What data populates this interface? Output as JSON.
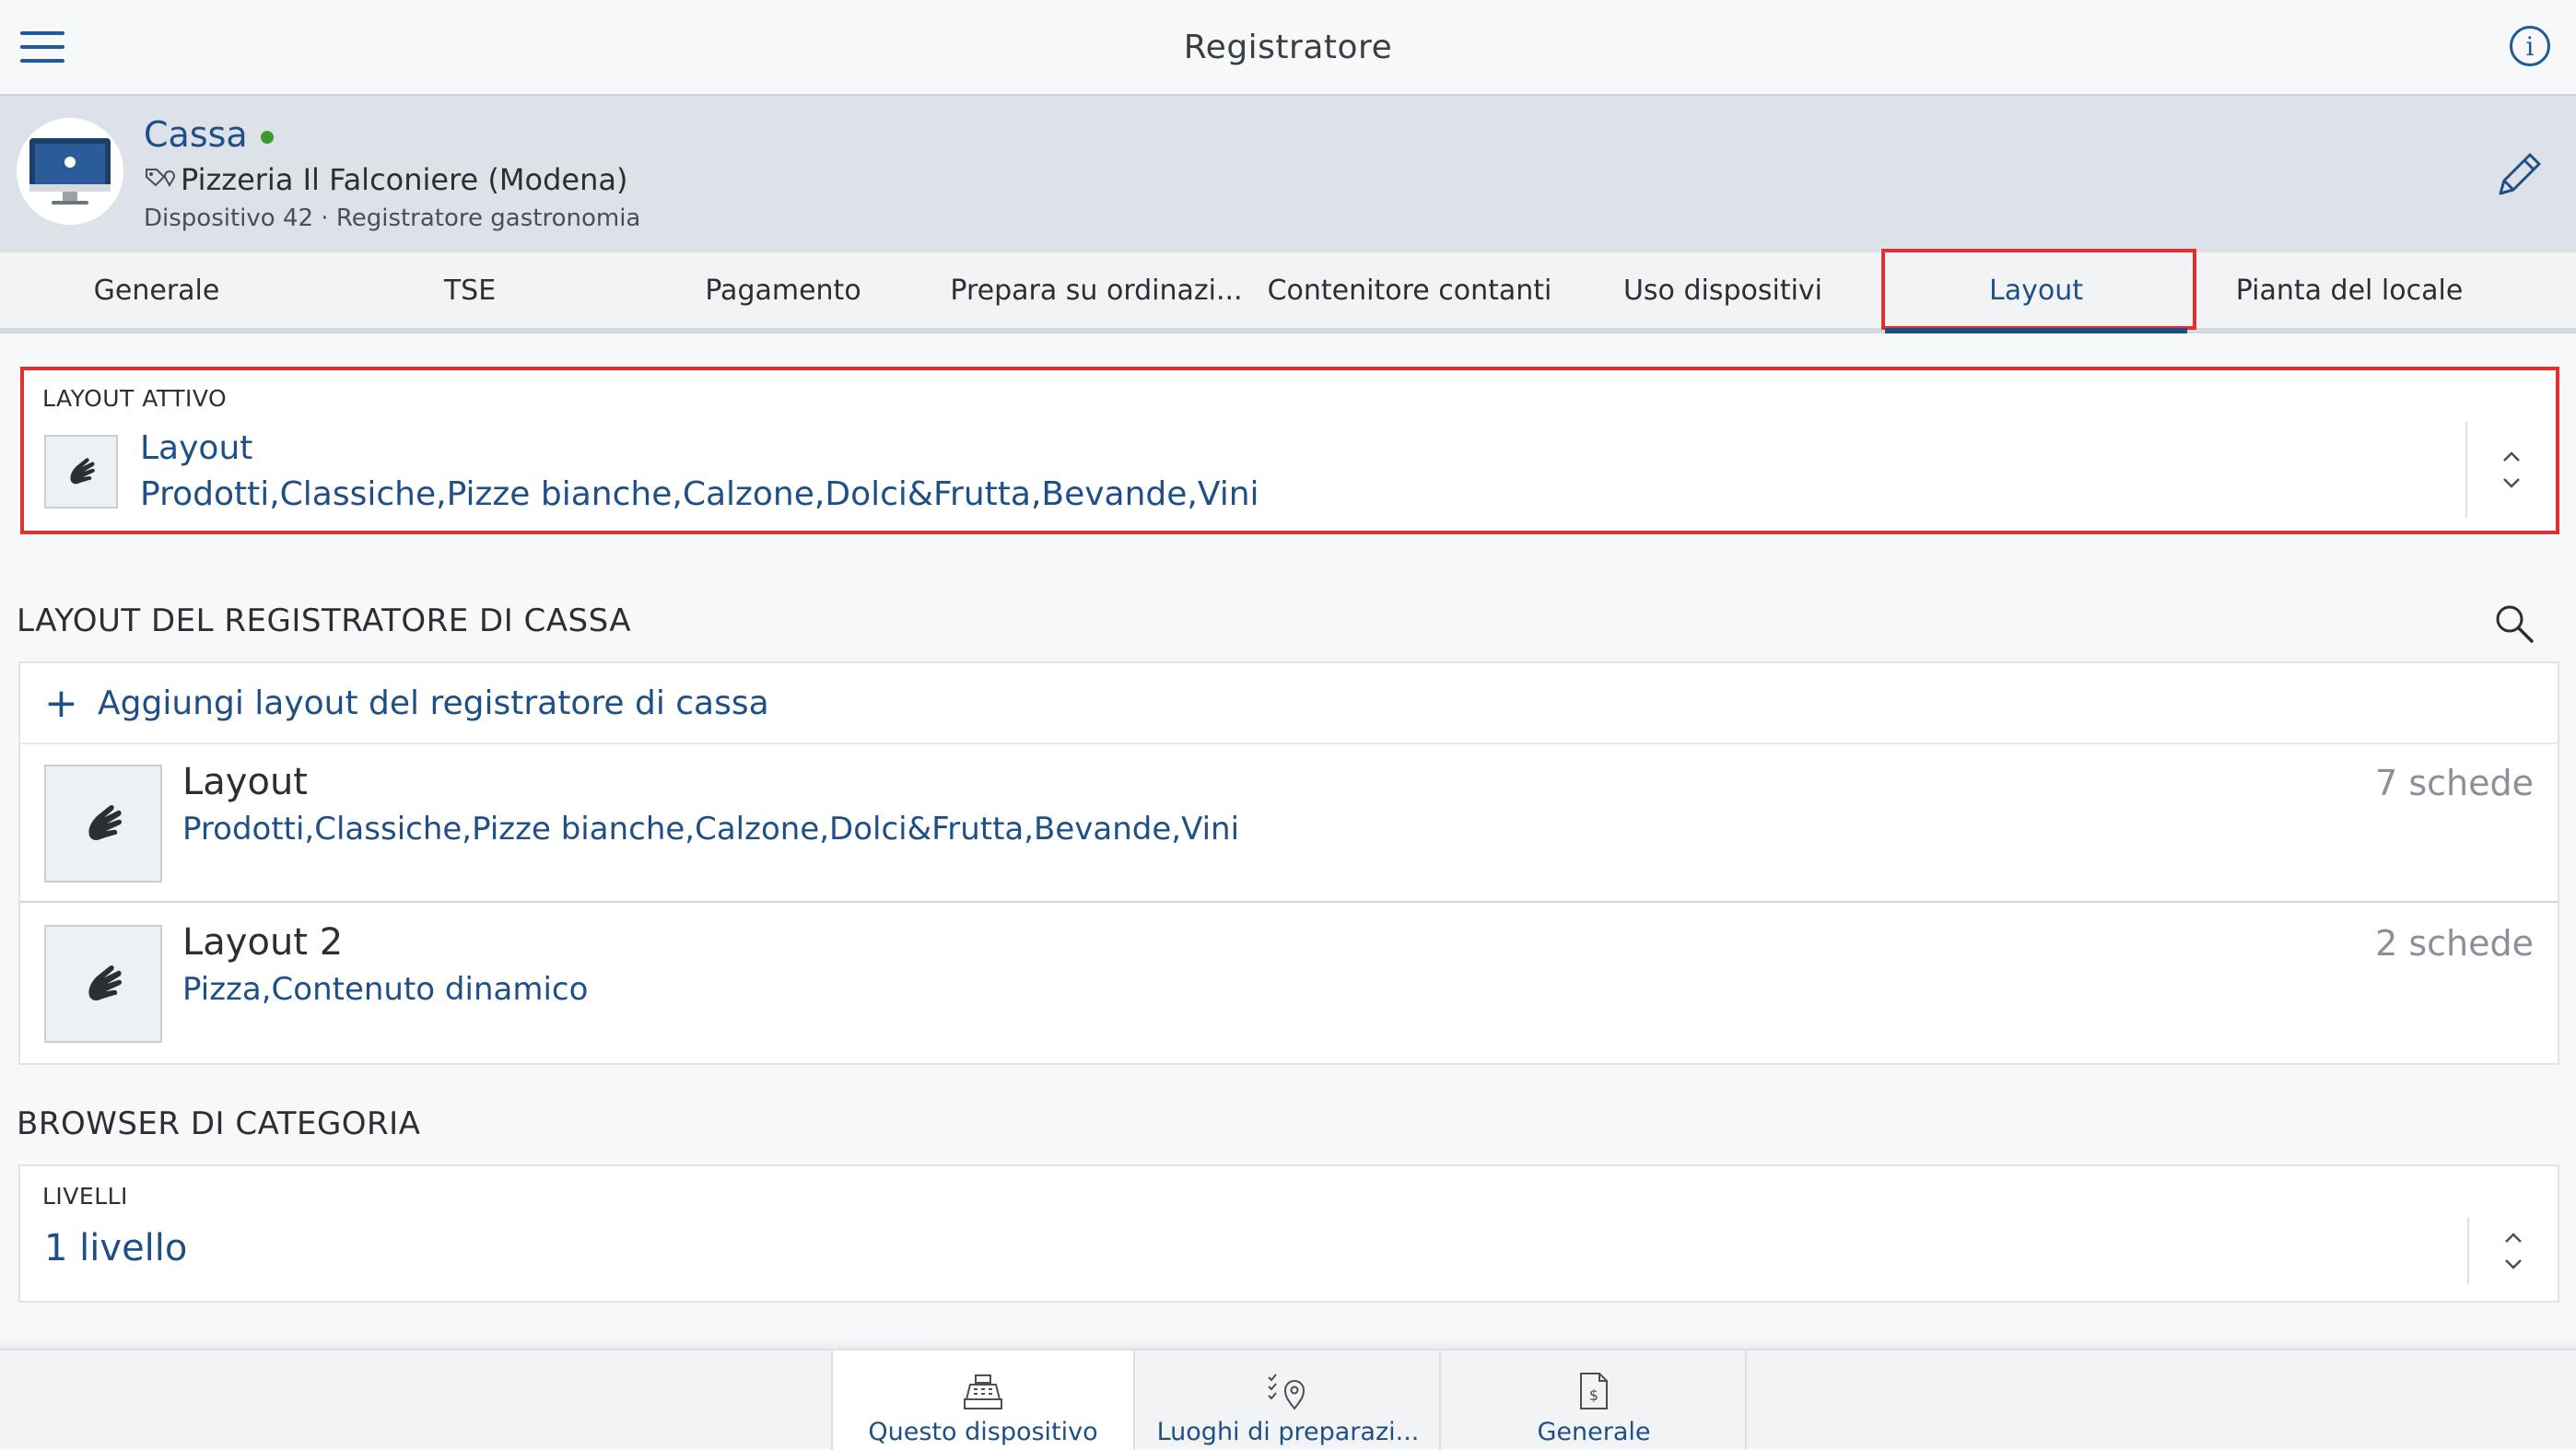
{
  "topbar": {
    "title": "Registratore"
  },
  "device": {
    "name": "Cassa",
    "location": "Pizzeria Il Falconiere (Modena)",
    "subtitle": "Dispositivo 42 · Registratore gastronomia"
  },
  "tabs": [
    {
      "label": "Generale"
    },
    {
      "label": "TSE"
    },
    {
      "label": "Pagamento"
    },
    {
      "label": "Prepara su ordinazi..."
    },
    {
      "label": "Contenitore contanti"
    },
    {
      "label": "Uso dispositivi"
    },
    {
      "label": "Layout"
    },
    {
      "label": "Pianta del locale"
    }
  ],
  "active_layout": {
    "label": "LAYOUT ATTIVO",
    "title": "Layout",
    "subtitle": "Prodotti,Classiche,Pizze bianche,Calzone,Dolci&Frutta,Bevande,Vini"
  },
  "layouts_section": {
    "title": "LAYOUT DEL REGISTRATORE DI CASSA",
    "add_label": "Aggiungi layout del registratore di cassa",
    "items": [
      {
        "title": "Layout",
        "subtitle": "Prodotti,Classiche,Pizze bianche,Calzone,Dolci&Frutta,Bevande,Vini",
        "count": "7 schede"
      },
      {
        "title": "Layout 2",
        "subtitle": "Pizza,Contenuto dinamico",
        "count": "2 schede"
      }
    ]
  },
  "category_browser": {
    "title": "BROWSER DI CATEGORIA",
    "levels_label": "LIVELLI",
    "levels_value": "1 livello"
  },
  "bottom_tabs": [
    {
      "label": "Questo dispositivo"
    },
    {
      "label": "Luoghi di preparazi..."
    },
    {
      "label": "Generale"
    }
  ],
  "colors": {
    "accent": "#1e4f86",
    "highlight": "#e03030",
    "online": "#3a9a2e"
  }
}
